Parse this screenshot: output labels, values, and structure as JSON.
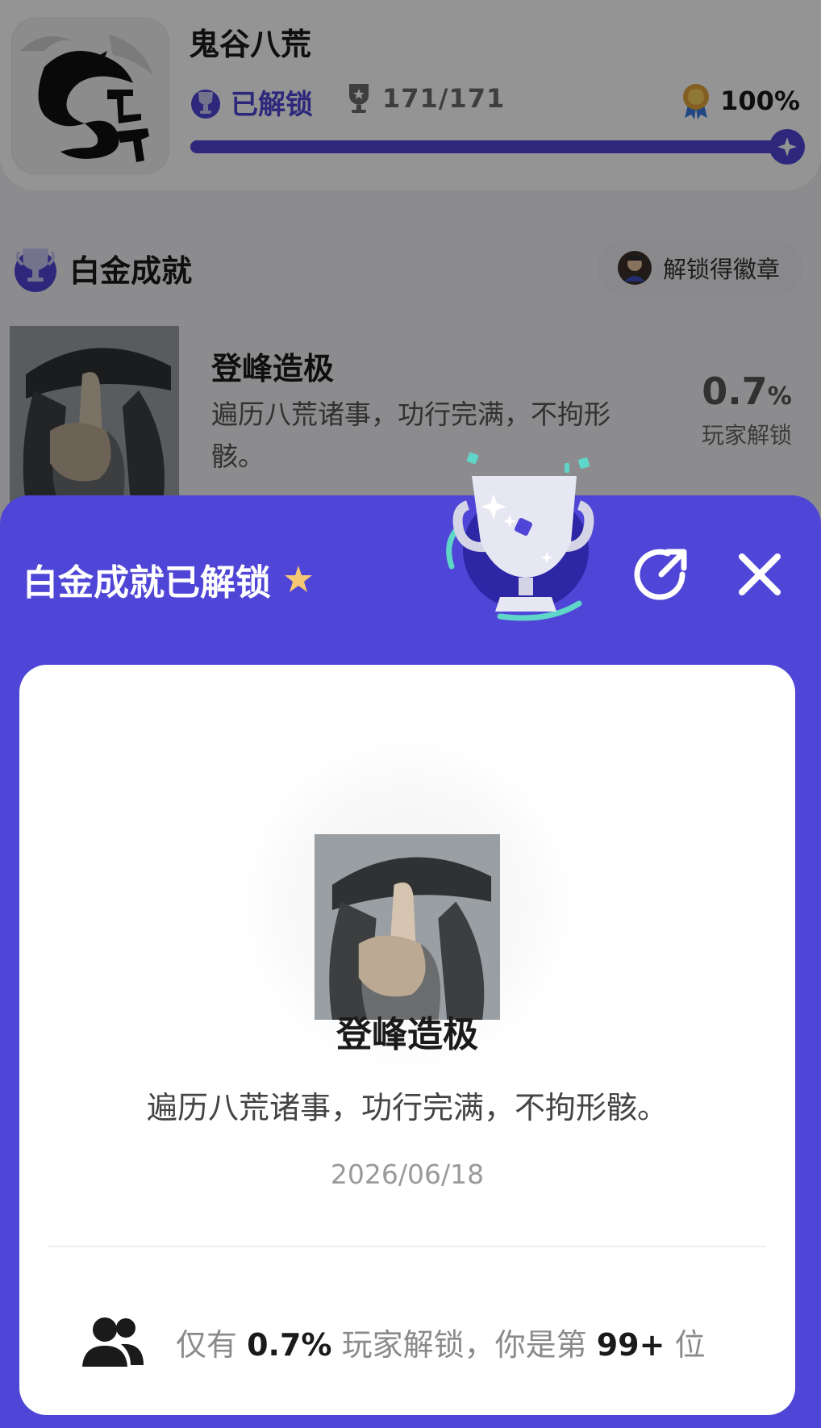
{
  "game": {
    "title": "鬼谷八荒",
    "unlocked_label": "已解锁",
    "achievement_count": "171/171",
    "completion_percent": "100%",
    "progress": 1.0
  },
  "platinum_section": {
    "title": "白金成就",
    "badge_button_label": "解锁得徽章"
  },
  "achievement": {
    "title": "登峰造极",
    "description": "遍历八荒诸事，功行完满，不拘形骸。",
    "rate_value": "0.7",
    "rate_unit": "%",
    "rate_label": "玩家解锁",
    "unlock_date": "2026/06/18"
  },
  "sheet": {
    "title": "白金成就已解锁",
    "footer": {
      "prefix": "仅有",
      "rate": "0.7%",
      "middle": "玩家解锁，你是第",
      "rank": "99+",
      "suffix": "位"
    }
  },
  "icons": [
    "dragon-logo-icon",
    "trophy-badge-icon",
    "cup-icon",
    "medal-icon",
    "player-badge-icon",
    "sparkle-star-icon",
    "trophy-illustration",
    "share-icon",
    "close-icon",
    "users-icon"
  ],
  "colors": {
    "accent": "#4f45d6",
    "sheet_bg": "#4f45d6",
    "card_bg": "#ffffff",
    "star": "#f7c873"
  }
}
